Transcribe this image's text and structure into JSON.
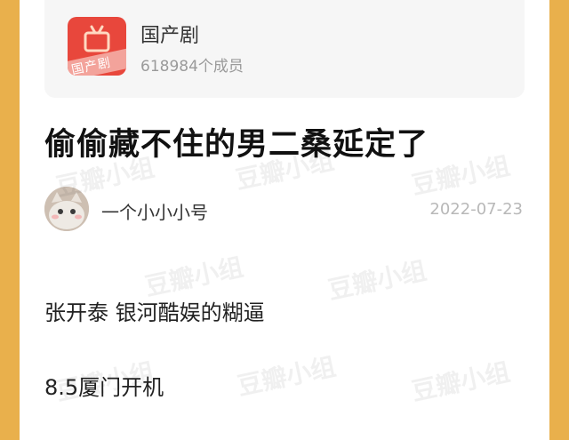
{
  "group": {
    "name": "国产剧",
    "members": "618984个成员",
    "icon_band_text": "国产剧"
  },
  "post": {
    "title": "偷偷藏不住的男二桑延定了",
    "author": "一个小小小号",
    "date": "2022-07-23",
    "lines": [
      "张开泰 银河酷娱的糊逼",
      "8.5厦门开机"
    ]
  },
  "watermark": "豆瓣小组",
  "colors": {
    "frame": "#e9b04c",
    "icon_red": "#e8473c"
  }
}
